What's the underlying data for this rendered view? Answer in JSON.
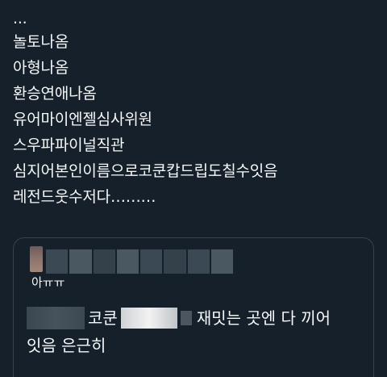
{
  "tweet": {
    "lines": [
      "...",
      "놀토나옴",
      "아형나옴",
      "환승연애나옴",
      "유어마이엔젤심사위원",
      "스우파파이널직관",
      "심지어본인이름으로코쿤캅드립도칠수잇음",
      "레전드웃수저다………"
    ]
  },
  "quote": {
    "handle": "아ㅠㅠ",
    "line1_a": "코쿤",
    "line1_b": "재밋는 곳엔 다 끼어",
    "line2": "잇음 은근히"
  }
}
